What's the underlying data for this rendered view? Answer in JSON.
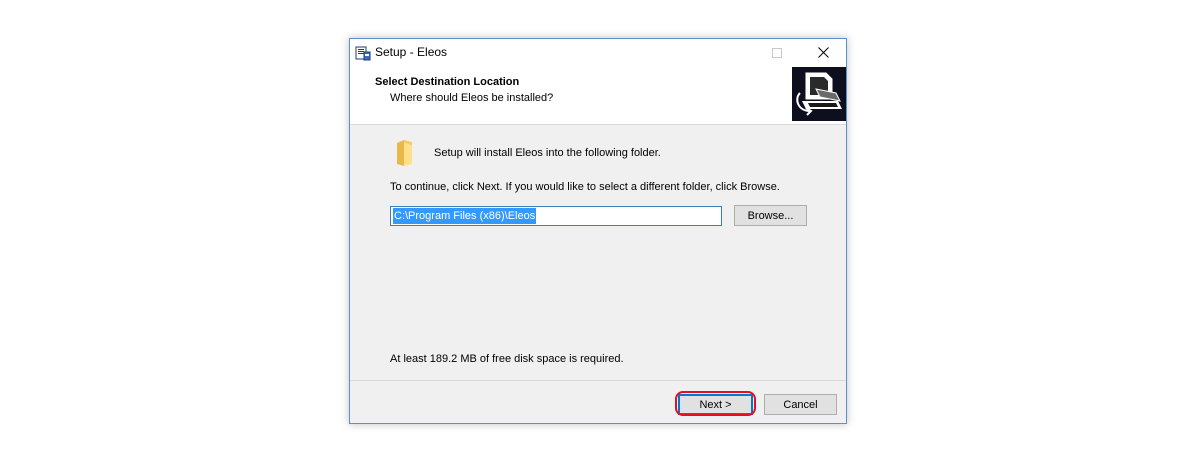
{
  "window": {
    "title": "Setup - Eleos"
  },
  "titlebar_buttons": {
    "minimize": "minimize-icon",
    "maximize": "maximize-icon",
    "close": "close-icon"
  },
  "header": {
    "title": "Select Destination Location",
    "subtitle": "Where should Eleos be installed?"
  },
  "content": {
    "intro": "Setup will install Eleos into the following folder.",
    "instruction": "To continue, click Next. If you would like to select a different folder, click Browse.",
    "path_value": "C:\\Program Files (x86)\\Eleos",
    "browse_label": "Browse...",
    "disk_space": "At least 189.2 MB of free disk space is required."
  },
  "footer": {
    "next_label": "Next >",
    "cancel_label": "Cancel"
  },
  "colors": {
    "highlight_ring": "#e3101f",
    "selection": "#3399ff",
    "focus_border": "#0078d7"
  }
}
